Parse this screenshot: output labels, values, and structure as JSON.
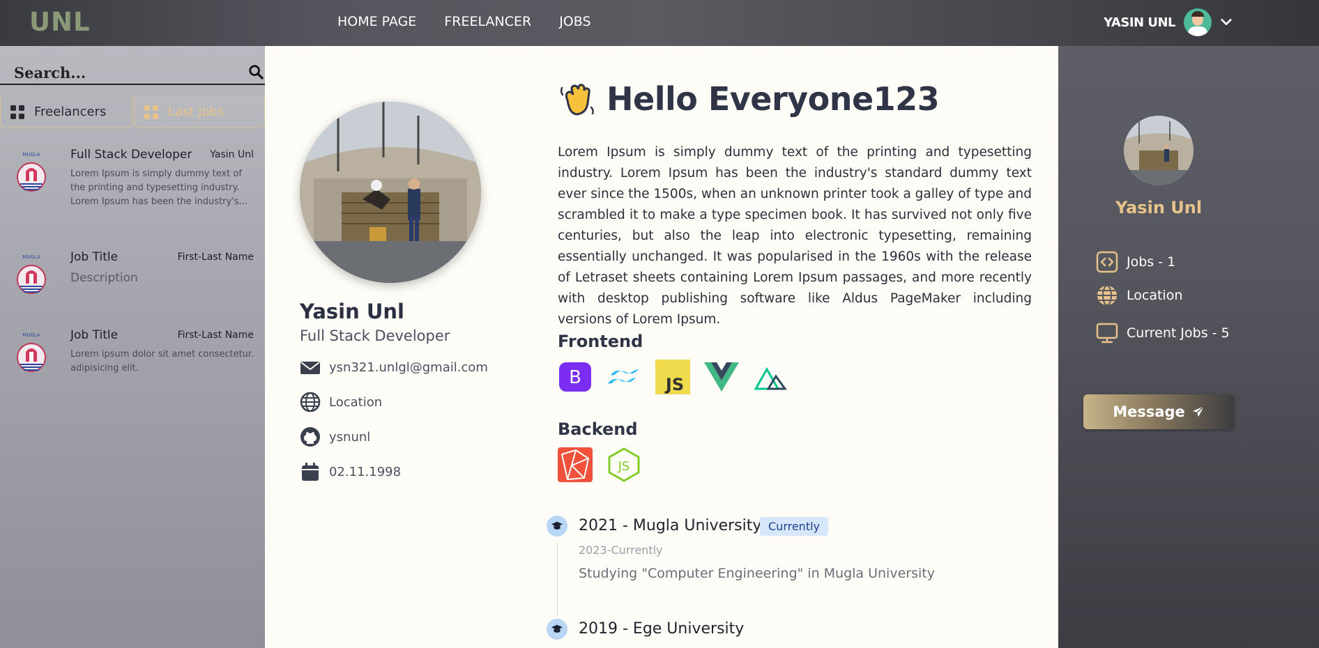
{
  "nav": {
    "logo": "UNL",
    "links": [
      "HOME PAGE",
      "FREELANCER",
      "JOBS"
    ],
    "user_name": "YASIN UNL"
  },
  "sidebar": {
    "search_placeholder": "Search...",
    "tabs": [
      {
        "label": "Freelancers",
        "icon": "grid-icon",
        "active": false
      },
      {
        "label": "Last Jobs",
        "icon": "grid-icon",
        "active": true
      }
    ],
    "jobs": [
      {
        "title": "Full Stack Developer",
        "name": "Yasin Unl",
        "description": "Lorem Ipsum is simply dummy text of the printing and typesetting industry. Lorem Ipsum has been the industry's..."
      },
      {
        "title": "Job Title",
        "name": "First-Last Name",
        "description": "Description"
      },
      {
        "title": "Job Title",
        "name": "First-Last Name",
        "description": "Lorem ipsum dolor sit amet consectetur. adipisicing elit."
      }
    ]
  },
  "profile": {
    "name": "Yasin Unl",
    "role": "Full Stack Developer",
    "email": "ysn321.unlgl@gmail.com",
    "location": "Location",
    "github": "ysnunl",
    "birthdate": "02.11.1998"
  },
  "main": {
    "greeting": "Hello Everyone123",
    "bio": "Lorem Ipsum is simply dummy text of the printing and typesetting industry. Lorem Ipsum has been the industry's standard dummy text ever since the 1500s, when an unknown printer took a galley of type and scrambled it to make a type specimen book. It has survived not only five centuries, but also the leap into electronic typesetting, remaining essentially unchanged. It was popularised in the 1960s with the release of Letraset sheets containing Lorem Ipsum passages, and more recently with desktop publishing software like Aldus PageMaker including versions of Lorem Ipsum.",
    "frontend_label": "Frontend",
    "frontend_icons": [
      "bootstrap-icon",
      "tailwind-icon",
      "javascript-icon",
      "vue-icon",
      "nuxt-icon"
    ],
    "backend_label": "Backend",
    "backend_icons": [
      "laravel-icon",
      "nodejs-icon"
    ],
    "education": [
      {
        "title": "2021 - Mugla University",
        "badge": "Currently",
        "period": "2023-Currently",
        "description": "Studying \"Computer Engineering\" in Mugla University"
      },
      {
        "title": "2019 - Ege University"
      }
    ]
  },
  "right": {
    "name": "Yasin Unl",
    "jobs": "Jobs - 1",
    "location": "Location",
    "current_jobs": "Current Jobs - 5",
    "message_label": "Message"
  },
  "colors": {
    "accent": "#e7c38b",
    "nav_bg": "#55565d",
    "page_bg": "#fdfcf6",
    "badge_bg": "#d6e6fb"
  }
}
